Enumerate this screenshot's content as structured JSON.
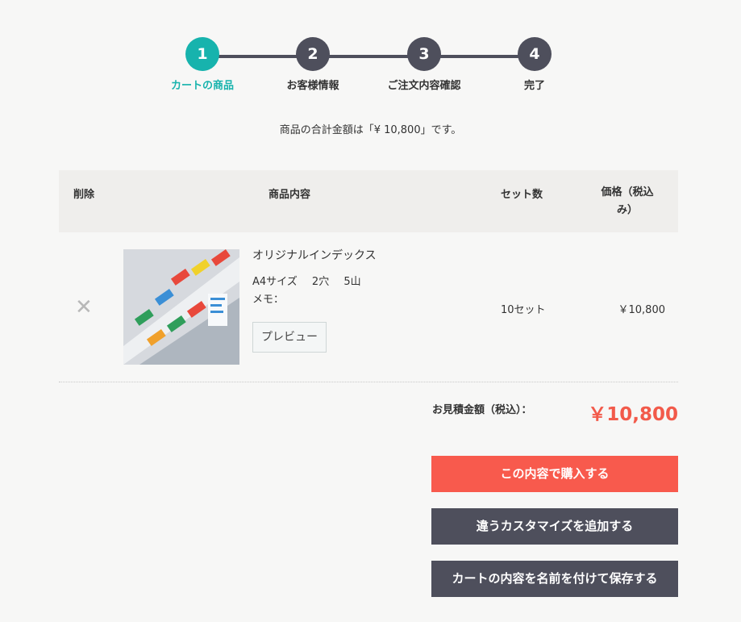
{
  "stepper": {
    "steps": [
      {
        "number": "1",
        "label": "カートの商品",
        "active": true
      },
      {
        "number": "2",
        "label": "お客様情報",
        "active": false
      },
      {
        "number": "3",
        "label": "ご注文内容確認",
        "active": false
      },
      {
        "number": "4",
        "label": "完了",
        "active": false
      }
    ]
  },
  "summary": {
    "text": "商品の合計金額は「¥ 10,800」です。"
  },
  "table": {
    "headers": {
      "delete": "削除",
      "content": "商品内容",
      "sets": "セット数",
      "price_line1": "価格（税込",
      "price_line2": "み）"
    },
    "rows": [
      {
        "delete_icon": "close-icon",
        "name": "オリジナルインデックス",
        "size": "A4サイズ",
        "holes": "2穴",
        "tabs": "5山",
        "memo": "メモ：",
        "preview_label": "プレビュー",
        "sets": "10セット",
        "price": "￥10,800"
      }
    ]
  },
  "total": {
    "label": "お見積金額（税込）：",
    "value": "￥10,800"
  },
  "actions": {
    "buy_label": "この内容で購入する",
    "add_label": "違うカスタマイズを追加する",
    "save_label": "カートの内容を名前を付けて保存する"
  },
  "colors": {
    "accent": "#17b3ad",
    "primary_button": "#f85a4d",
    "secondary_button": "#4e4f5c",
    "price": "#f25a4a"
  }
}
